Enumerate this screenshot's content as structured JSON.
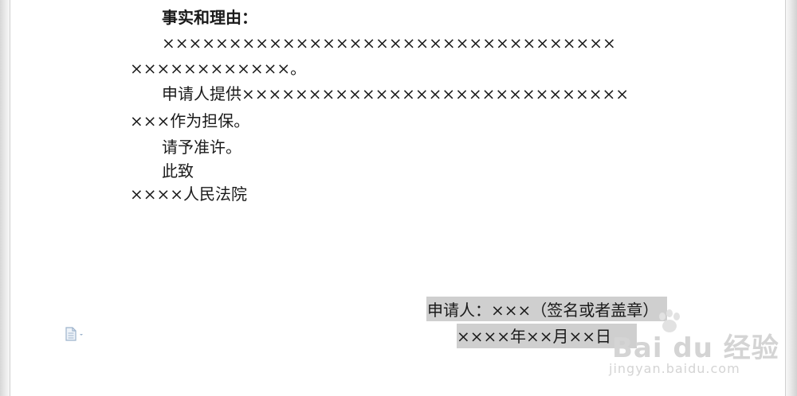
{
  "document": {
    "heading": "事实和理由：",
    "facts_line1": "××××××××××××××××××××××××××××××××××",
    "facts_line2": "××××××××××××。",
    "guarantee_line1": "申请人提供×××××××××××××××××××××××××××××",
    "guarantee_line2": "×××作为担保。",
    "request": "请予准许。",
    "closing": "此致",
    "court": "××××人民法院",
    "applicant_signature": "申请人：×××（签名或者盖章）",
    "date": "××××年××月××日"
  },
  "watermark": {
    "brand": "Bai du 经验",
    "url": "jingyan.baidu.com"
  },
  "icons": {
    "paste_options": "document-icon",
    "dropdown": "chevron-down-icon"
  },
  "colors": {
    "selection_highlight": "#cfcfcf",
    "watermark": "#d4d4d4",
    "icon": "#9db3cc"
  }
}
